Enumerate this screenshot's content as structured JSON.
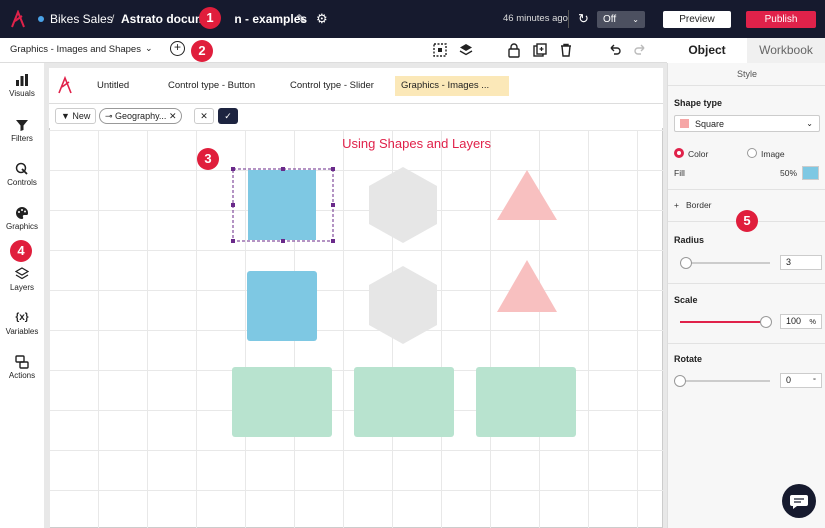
{
  "topbar": {
    "app_name": "Bikes Sales",
    "separator": "/",
    "doc_name": "Astrato docume",
    "doc_name_tail": "n - examples",
    "last_saved": "46 minutes ago",
    "toggle_value": "Off",
    "preview_label": "Preview",
    "publish_label": "Publish",
    "pencil_icon": "✎",
    "gear_icon": "⚙",
    "refresh_icon": "↻",
    "chevron": "⌄"
  },
  "toolbar": {
    "sheet_selector": "Graphics - Images and Shapes",
    "add_icon": "+"
  },
  "panel_tabs": {
    "object": "Object",
    "workbook": "Workbook"
  },
  "left_rail": [
    {
      "label": "Visuals"
    },
    {
      "label": "Filters"
    },
    {
      "label": "Controls"
    },
    {
      "label": "Graphics"
    },
    {
      "label": "Layers"
    },
    {
      "label": "Variables"
    },
    {
      "label": "Actions"
    }
  ],
  "sheet_tabs": [
    {
      "label": "Untitled"
    },
    {
      "label": "Control type - Button"
    },
    {
      "label": "Control type - Slider"
    },
    {
      "label": "Graphics - Images ..."
    }
  ],
  "filterbar": {
    "new_label": "New",
    "chip_label": "Geography...",
    "chip_close": "✕",
    "cancel": "✕",
    "confirm": "✓"
  },
  "canvas": {
    "heading": "Using Shapes and Layers"
  },
  "panel": {
    "style_label": "Style",
    "shape_type_label": "Shape type",
    "shape_type_value": "Square",
    "color_label": "Color",
    "image_label": "Image",
    "fill_label": "Fill",
    "fill_pct": "50%",
    "border_label": "Border",
    "border_prefix": "+",
    "radius_label": "Radius",
    "radius_value": "3",
    "scale_label": "Scale",
    "scale_value": "100",
    "scale_unit": "%",
    "rotate_label": "Rotate",
    "rotate_value": "0",
    "rotate_unit": "°"
  },
  "callouts": [
    "1",
    "2",
    "3",
    "4",
    "5"
  ],
  "colors": {
    "accent": "#e0224a",
    "topbar": "#161a2e",
    "square": "#7ec8e3",
    "hexagon": "#e6e6e6",
    "triangle": "#f8c0c0",
    "rect": "#b8e3cf",
    "active_tab": "#fbe8b8"
  }
}
